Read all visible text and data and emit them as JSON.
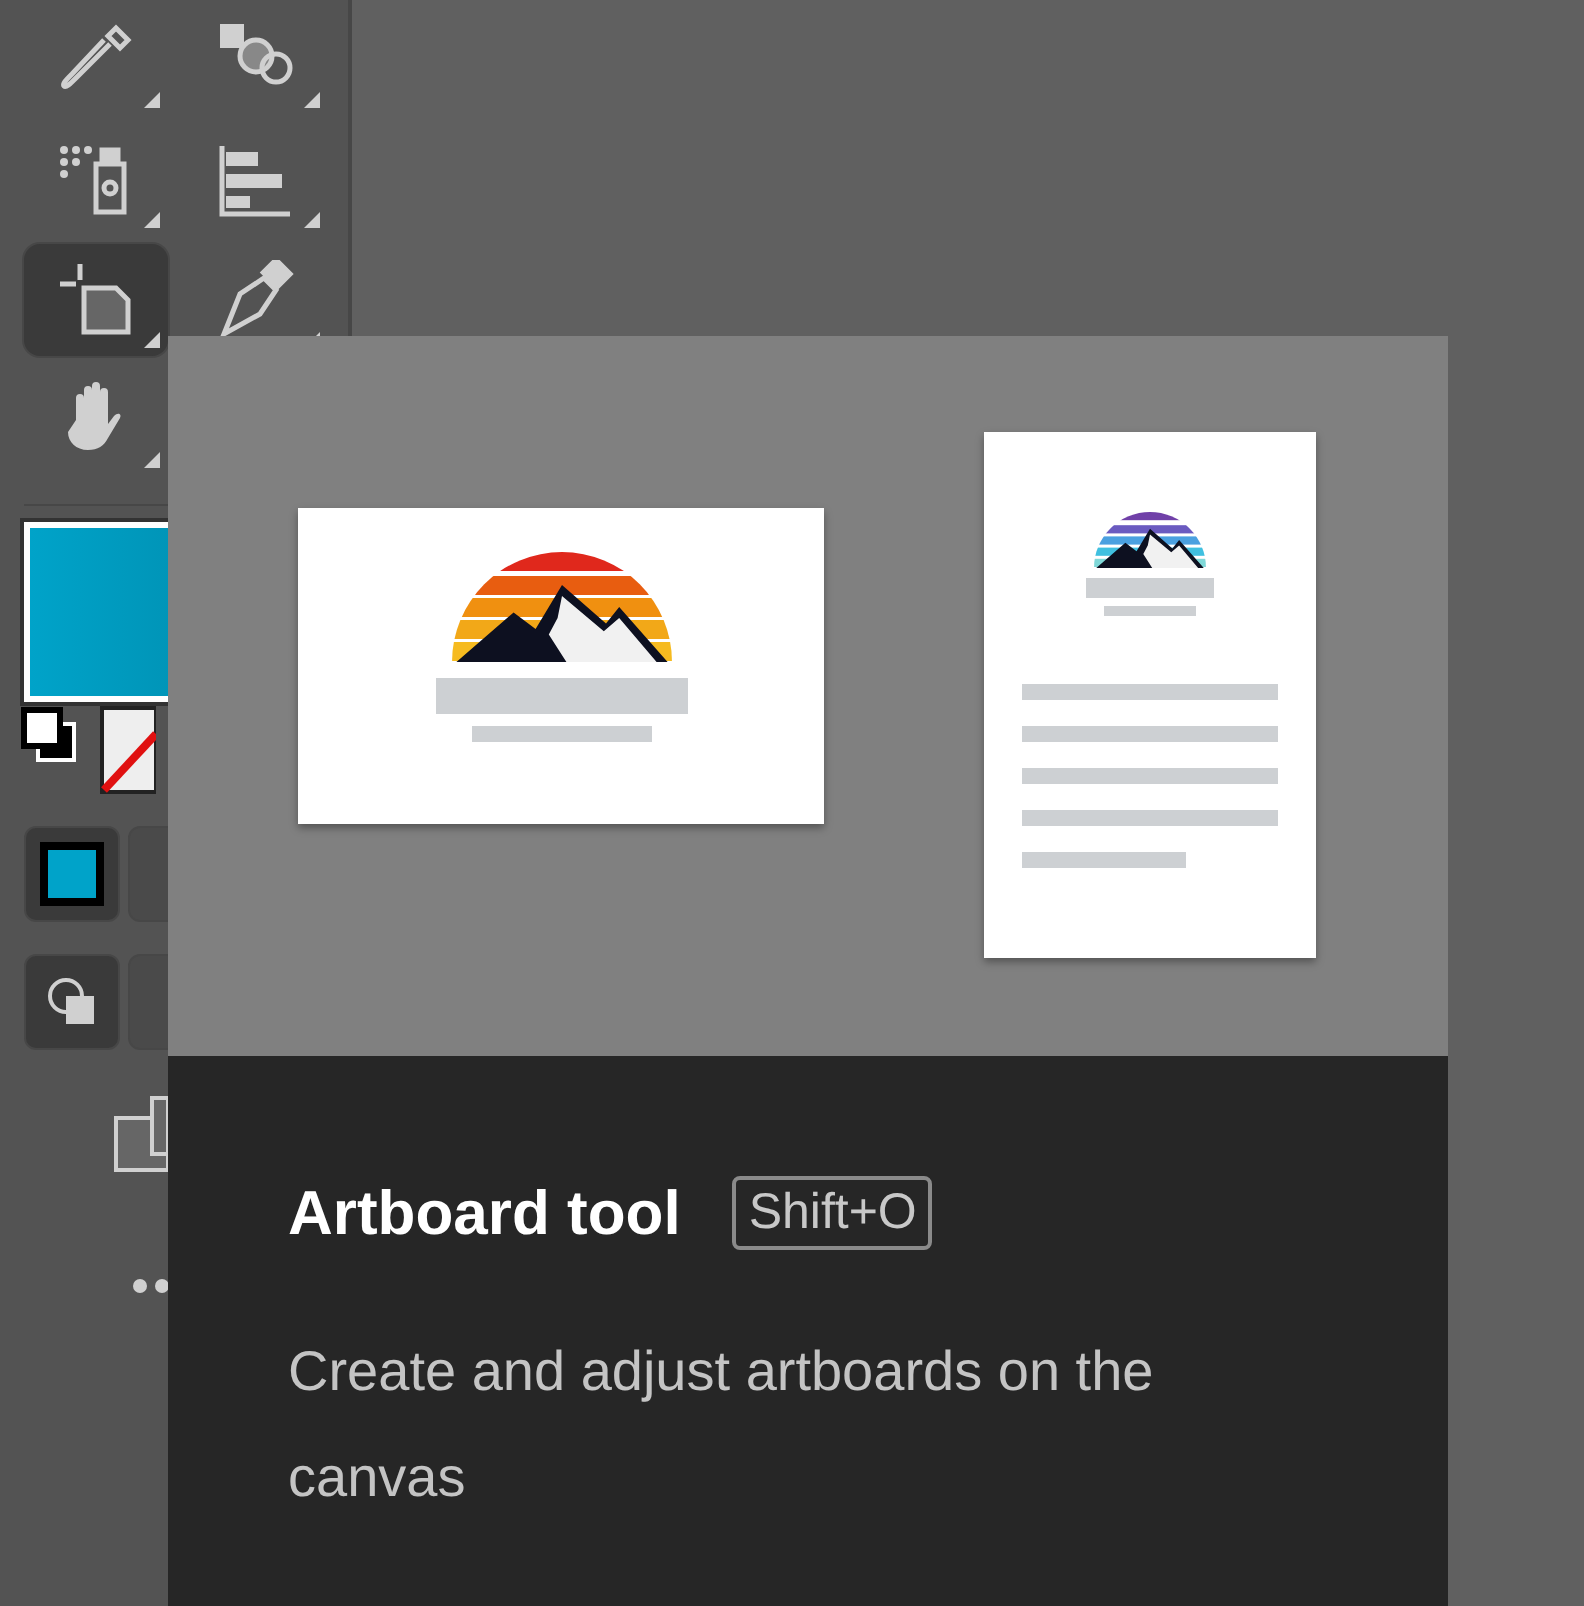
{
  "toolbar": {
    "tools": [
      {
        "kind": "eyedropper",
        "selected": false
      },
      {
        "kind": "blend",
        "selected": false
      },
      {
        "kind": "spray",
        "selected": false
      },
      {
        "kind": "graph",
        "selected": false
      },
      {
        "kind": "artboard",
        "selected": true
      },
      {
        "kind": "pen",
        "selected": false
      },
      {
        "kind": "hand",
        "selected": false
      }
    ]
  },
  "tooltip": {
    "title": "Artboard tool",
    "shortcut": "Shift+O",
    "description": "Create and adjust artboards on the canvas"
  }
}
